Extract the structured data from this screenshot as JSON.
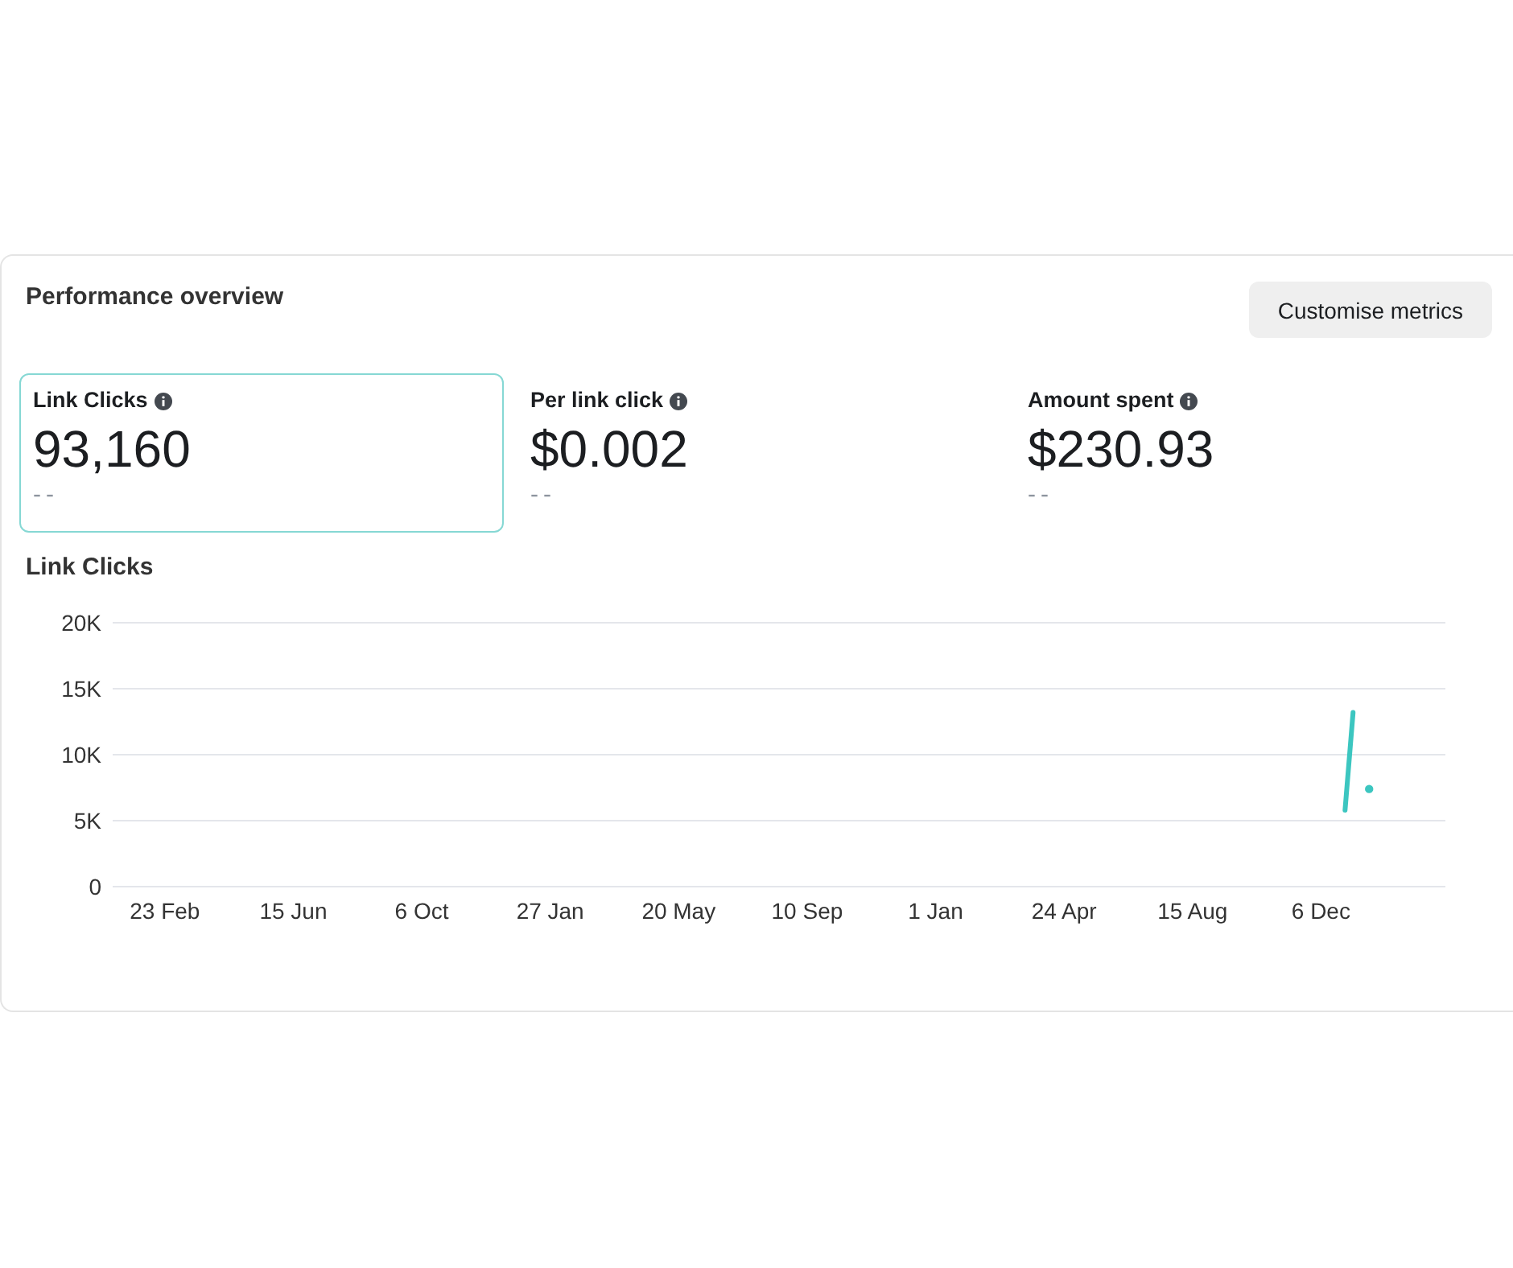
{
  "header": {
    "title": "Performance overview",
    "button": "Customise metrics"
  },
  "metrics": [
    {
      "label": "Link Clicks",
      "value": "93,160",
      "comparison": "--",
      "selected": true
    },
    {
      "label": "Per link click",
      "value": "$0.002",
      "comparison": "--",
      "selected": false
    },
    {
      "label": "Amount spent",
      "value": "$230.93",
      "comparison": "--",
      "selected": false
    }
  ],
  "chart": {
    "chart_data": {
      "type": "line",
      "title": "Link Clicks",
      "grid": true,
      "categories": [
        null,
        null,
        null,
        null,
        null,
        null,
        "23 Feb",
        null,
        null,
        null,
        null,
        null,
        null,
        null,
        null,
        null,
        null,
        null,
        null,
        null,
        null,
        null,
        "15 Jun",
        null,
        null,
        null,
        null,
        null,
        null,
        null,
        null,
        null,
        null,
        null,
        null,
        null,
        null,
        null,
        "6 Oct",
        null,
        null,
        null,
        null,
        null,
        null,
        null,
        null,
        null,
        null,
        null,
        null,
        null,
        null,
        null,
        "27 Jan",
        null,
        null,
        null,
        null,
        null,
        null,
        null,
        null,
        null,
        null,
        null,
        null,
        null,
        null,
        null,
        "20 May",
        null,
        null,
        null,
        null,
        null,
        null,
        null,
        null,
        null,
        null,
        null,
        null,
        null,
        null,
        null,
        "10 Sep",
        null,
        null,
        null,
        null,
        null,
        null,
        null,
        null,
        null,
        null,
        null,
        null,
        null,
        null,
        null,
        "1 Jan",
        null,
        null,
        null,
        null,
        null,
        null,
        null,
        null,
        null,
        null,
        null,
        null,
        null,
        null,
        null,
        "24 Apr",
        null,
        null,
        null,
        null,
        null,
        null,
        null,
        null,
        null,
        null,
        null,
        null,
        null,
        null,
        null,
        "15 Aug",
        null,
        null,
        null,
        null,
        null,
        null,
        null,
        null,
        null,
        null,
        null,
        null,
        null,
        null,
        null,
        "6 Dec",
        null,
        null,
        null,
        null,
        null,
        null,
        null,
        null,
        null,
        null,
        null,
        null,
        null,
        null,
        null
      ],
      "ylim": [
        0,
        20000
      ],
      "yticks": [
        {
          "value": 0,
          "label": "0"
        },
        {
          "value": 5000,
          "label": "5K"
        },
        {
          "value": 10000,
          "label": "10K"
        },
        {
          "value": 15000,
          "label": "15K"
        },
        {
          "value": 20000,
          "label": "20K"
        }
      ],
      "series": [
        {
          "color": "#3cc6c0",
          "values": [
            null,
            null,
            null,
            null,
            null,
            null,
            null,
            null,
            null,
            null,
            null,
            null,
            null,
            null,
            null,
            null,
            null,
            null,
            null,
            null,
            null,
            null,
            null,
            null,
            null,
            null,
            null,
            null,
            null,
            null,
            null,
            null,
            null,
            null,
            null,
            null,
            null,
            null,
            null,
            null,
            null,
            null,
            null,
            null,
            null,
            null,
            null,
            null,
            null,
            null,
            null,
            null,
            null,
            null,
            null,
            null,
            null,
            null,
            null,
            null,
            null,
            null,
            null,
            null,
            null,
            null,
            null,
            null,
            null,
            null,
            null,
            null,
            null,
            null,
            null,
            null,
            null,
            null,
            null,
            null,
            null,
            null,
            null,
            null,
            null,
            null,
            null,
            null,
            null,
            null,
            null,
            null,
            null,
            null,
            null,
            null,
            null,
            null,
            null,
            null,
            null,
            null,
            null,
            null,
            null,
            null,
            null,
            null,
            null,
            null,
            null,
            null,
            null,
            null,
            null,
            null,
            null,
            null,
            null,
            null,
            null,
            null,
            null,
            null,
            null,
            null,
            null,
            null,
            null,
            null,
            null,
            null,
            null,
            null,
            null,
            null,
            null,
            null,
            null,
            null,
            null,
            null,
            null,
            null,
            null,
            null,
            null,
            null,
            null,
            null,
            null,
            null,
            null,
            5800,
            13200,
            null,
            7400,
            null,
            null,
            null,
            null,
            null,
            null,
            null,
            null,
            null
          ]
        }
      ]
    }
  }
}
